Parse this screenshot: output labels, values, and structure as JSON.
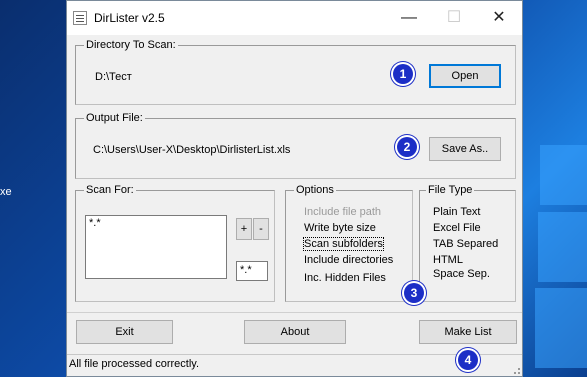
{
  "desktop": {
    "side_text": "xe"
  },
  "window": {
    "title": "DirLister v2.5"
  },
  "directory": {
    "legend": "Directory To Scan:",
    "path": "D:\\Тест",
    "open_label": "Open"
  },
  "output": {
    "legend": "Output File:",
    "path": "C:\\Users\\User-X\\Desktop\\DirlisterList.xls",
    "save_label": "Save As.."
  },
  "scan_for": {
    "legend": "Scan For:",
    "list_items": [
      "*.*"
    ],
    "add_label": "+",
    "remove_label": "-",
    "pattern_value": "*.*"
  },
  "options": {
    "legend": "Options",
    "items": [
      {
        "label": "Include file path",
        "enabled": false
      },
      {
        "label": "Write byte size",
        "enabled": true
      },
      {
        "label": "Scan subfolders",
        "enabled": true,
        "focused": true
      },
      {
        "label": "Include directories",
        "enabled": true
      },
      {
        "label": "Inc. Hidden Files",
        "enabled": true
      }
    ]
  },
  "file_type": {
    "legend": "File Type",
    "items": [
      "Plain Text",
      "Excel File",
      "TAB Separed",
      "HTML",
      "Space Sep."
    ]
  },
  "buttons": {
    "exit_label": "Exit",
    "about_label": "About",
    "make_list_label": "Make List"
  },
  "status": {
    "text": "All file processed correctly."
  },
  "badges": {
    "b1": "1",
    "b2": "2",
    "b3": "3",
    "b4": "4"
  }
}
